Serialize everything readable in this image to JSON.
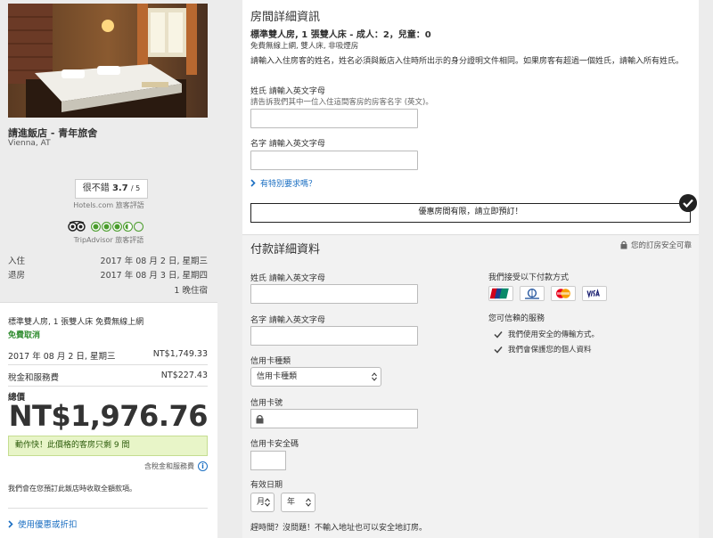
{
  "hotel": {
    "name": "請進飯店 - 青年旅舍",
    "location": "Vienna, AT",
    "rating_label": "很不錯",
    "rating_score": "3.7",
    "rating_max": "/ 5",
    "rating_source": "Hotels.com 旅客評語",
    "tripadvisor_rating": 3.5,
    "tripadvisor_source": "TripAdvisor 旅客評語"
  },
  "stay": {
    "checkin_label": "入住",
    "checkin_date": "2017 年 08 月 2 日, 星期三",
    "checkout_label": "退房",
    "checkout_date": "2017 年 08 月 3 日, 星期四",
    "nights": "1 晚住宿"
  },
  "price": {
    "room_summary": "標準雙人房, 1 張雙人床 免費無線上網",
    "cancellation": "免費取消",
    "night_date": "2017 年 08 月 2 日, 星期三",
    "night_price": "NT$1,749.33",
    "tax_label": "稅金和服務費",
    "tax_price": "NT$227.43",
    "total_label": "總價",
    "total_price": "NT$1,976.76",
    "urgency": "動作快！此價格的客房只剩 9 間",
    "tax_note": "含稅金和服務費",
    "payment_note": "我們會在您預訂此飯店時收取全額款項。",
    "coupon_link": "使用優惠或折扣"
  },
  "room_details": {
    "title": "房間詳細資訊",
    "room_type": "標準雙人房, 1 張雙人床 - 成人：2，兒童：0",
    "amenities": "免費無線上網, 雙人床, 非吸煙房",
    "instructions": "請輸入入住房客的姓名，姓名必須與飯店入住時所出示的身分證明文件相同。如果房客有超過一個姓氏，請輸入所有姓氏。",
    "last_name_label": "姓氏 請輸入英文字母",
    "last_name_hint": "請告訴我們其中一位入住這間客房的房客名字 (英文)。",
    "first_name_label": "名字 請輸入英文字母",
    "special_request": "有特別要求嗎？",
    "alert": "優惠房間有限，請立即預訂！"
  },
  "payment": {
    "title": "付款詳細資料",
    "secure_note": "您的訂房安全可靠",
    "last_name_label": "姓氏 請輸入英文字母",
    "first_name_label": "名字 請輸入英文字母",
    "card_type_label": "信用卡種類",
    "card_type_value": "信用卡種類",
    "card_number_label": "信用卡號",
    "cvc_label": "信用卡安全碼",
    "expiry_label": "有效日期",
    "month_value": "月",
    "year_value": "年",
    "accepted_title": "我們接受以下付款方式",
    "trust_title": "您可信賴的服務",
    "trust_1": "我們使用安全的傳輸方式。",
    "trust_2": "我們會保護您的個人資料",
    "bottom_note": "趕時間？沒問題！不輸入地址也可以安全地訂房。",
    "cards": [
      "UnionPay",
      "Diners Club",
      "MasterCard",
      "VISA"
    ]
  },
  "colors": {
    "link": "#1a6ec2",
    "green": "#2e8b2e",
    "urgent_bg": "#e8f5c8"
  }
}
